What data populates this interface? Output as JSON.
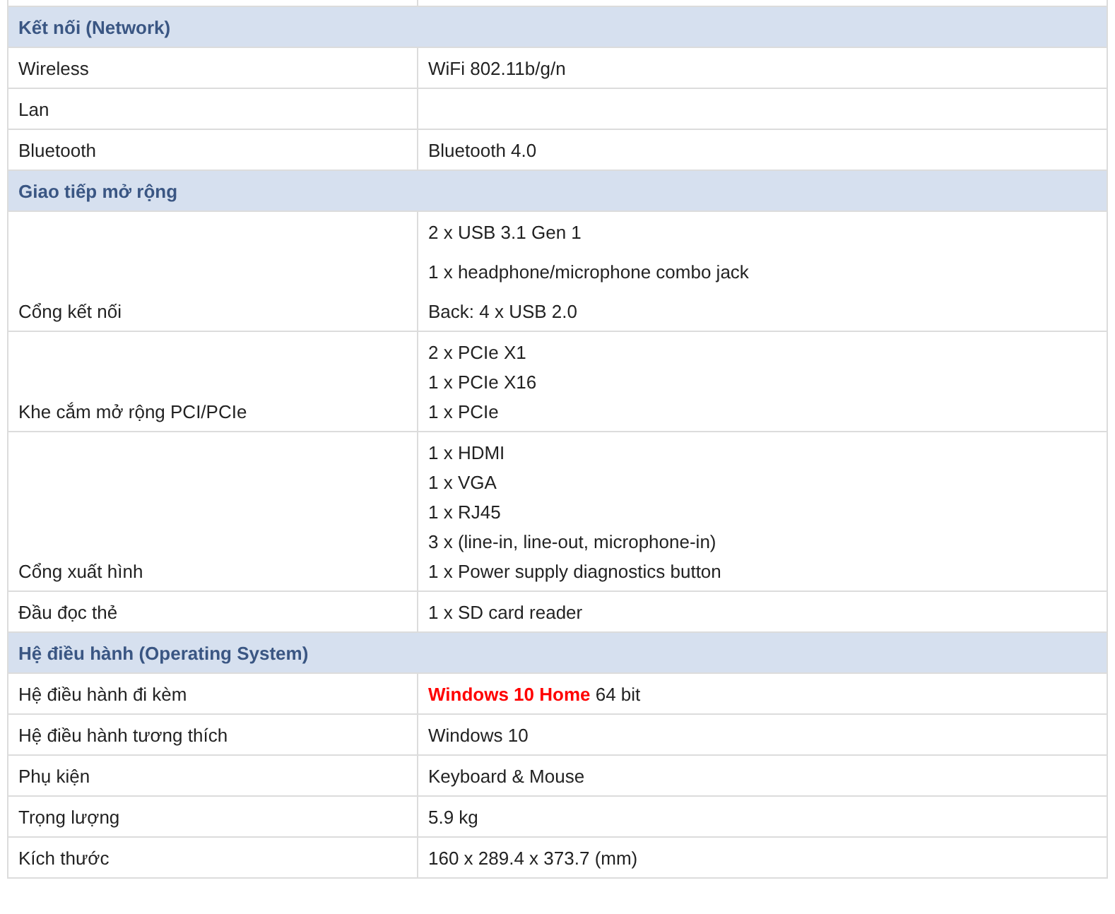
{
  "sections": [
    {
      "title": "Kết nối (Network)",
      "rows": [
        {
          "label": "Wireless",
          "lines": [
            "WiFi 802.11b/g/n"
          ],
          "kind": "lines"
        },
        {
          "label": "Lan",
          "lines": []
        },
        {
          "label": "Bluetooth",
          "lines": [
            "Bluetooth 4.0"
          ],
          "kind": "lines"
        }
      ]
    },
    {
      "title": "Giao tiếp mở rộng",
      "rows": [
        {
          "label": "Cổng kết nối",
          "lines": [
            "2 x USB 3.1 Gen 1",
            "1 x headphone/microphone combo jack",
            "Back: 4 x USB 2.0"
          ],
          "kind": "paragraphs"
        },
        {
          "label": "Khe cắm mở rộng PCI/PCIe",
          "lines": [
            "2 x PCIe X1",
            "1 x PCIe X16",
            "1 x PCIe"
          ],
          "kind": "lines"
        },
        {
          "label": "Cổng xuất hình",
          "lines": [
            "1 x HDMI",
            "1 x VGA",
            "1 x RJ45",
            "3 x (line-in, line-out, microphone-in)",
            "1 x Power supply diagnostics button"
          ],
          "kind": "lines"
        },
        {
          "label": "Đầu đọc thẻ",
          "lines": [
            "1 x SD card reader"
          ],
          "kind": "lines"
        }
      ]
    },
    {
      "title": "Hệ điều hành (Operating System)",
      "rows": [
        {
          "label": "Hệ điều hành đi kèm",
          "lines": [
            "**Windows 10 Home** 64 bit"
          ],
          "kind": "lines"
        },
        {
          "label": "Hệ điều hành tương thích",
          "lines": [
            "Windows 10"
          ],
          "kind": "lines"
        },
        {
          "label": "Phụ kiện",
          "lines": [
            "Keyboard & Mouse"
          ],
          "kind": "lines"
        },
        {
          "label": "Trọng lượng",
          "lines": [
            "5.9 kg"
          ],
          "kind": "lines"
        },
        {
          "label": "Kích thước",
          "lines": [
            "160 x 289.4 x 373.7 (mm)"
          ],
          "kind": "lines"
        }
      ]
    }
  ]
}
